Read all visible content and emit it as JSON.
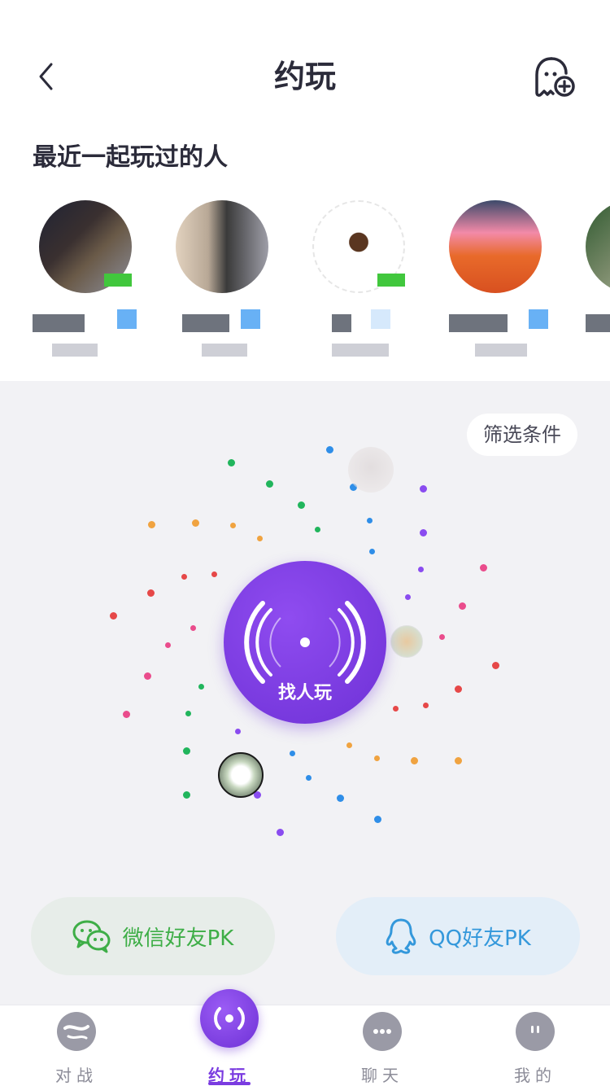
{
  "header": {
    "title": "约玩",
    "back_icon": "chevron-left-icon",
    "add_friend_icon": "add-friend-icon"
  },
  "recent": {
    "title": "最近一起玩过的人",
    "players": [
      {
        "avatar_colors": [
          "#2c3246",
          "#5a4a3a",
          "#8c8f9c"
        ],
        "online": true
      },
      {
        "avatar_colors": [
          "#d8c7b5",
          "#3a3a3a",
          "#9e9ea8"
        ],
        "online": false
      },
      {
        "avatar_colors": [
          "#ffffff",
          "#5a3620",
          "#e0e0e0"
        ],
        "online": true
      },
      {
        "avatar_colors": [
          "#3c4a6a",
          "#e86a2a",
          "#f38aa8"
        ],
        "online": false
      },
      {
        "avatar_colors": [
          "#2f5a30",
          "#7a8a6a",
          "#c0c8b0"
        ],
        "online": false
      }
    ]
  },
  "radar": {
    "filter_label": "筛选条件",
    "find_label": "找人玩",
    "dot_colors": {
      "green": "#21b55c",
      "blue": "#2f8ee8",
      "purple": "#8a4cf0",
      "orange": "#f0a340",
      "red": "#e64848",
      "pink": "#ea4c8c"
    }
  },
  "share": {
    "wechat_label": "微信好友PK",
    "qq_label": "QQ好友PK",
    "wechat_color": "#3eae47",
    "qq_color": "#3498db"
  },
  "tabs": [
    {
      "label": "对战",
      "icon": "battle-icon"
    },
    {
      "label": "约玩",
      "icon": "radar-icon",
      "active": true
    },
    {
      "label": "聊天",
      "icon": "chat-icon"
    },
    {
      "label": "我的",
      "icon": "profile-icon"
    }
  ],
  "accent": "#7a3be0"
}
